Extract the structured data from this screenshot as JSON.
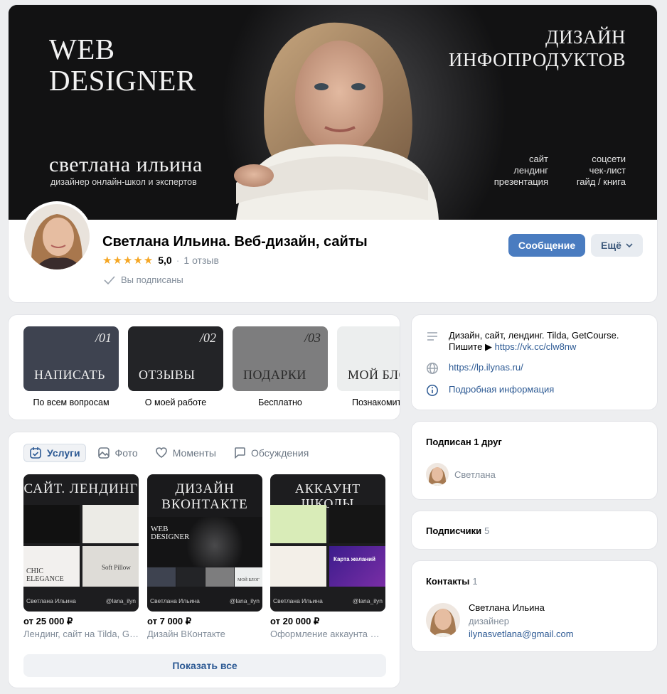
{
  "cover": {
    "title_line1": "WEB",
    "title_line2": "DESIGNER",
    "name": "светлана ильина",
    "subtitle": "дизайнер онлайн-школ и экспертов",
    "right_line1": "ДИЗАЙН",
    "right_line2": "ИНФОПРОДУКТОВ",
    "list_left": [
      "сайт",
      "лендинг",
      "презентация"
    ],
    "list_right": [
      "соцсети",
      "чек-лист",
      "гайд / книга"
    ]
  },
  "group": {
    "title": "Светлана Ильина. Веб-дизайн, сайты",
    "rating": "5,0",
    "reviews": "1 отзыв",
    "subscribed": "Вы подписаны",
    "message_button": "Сообщение",
    "more_button": "Ещё"
  },
  "quick_links": [
    {
      "num": "/01",
      "title": "НАПИСАТЬ",
      "caption": "По всем вопросам",
      "color": "#3e4350"
    },
    {
      "num": "/02",
      "title": "ОТЗЫВЫ",
      "caption": "О моей работе",
      "color": "#232427"
    },
    {
      "num": "/03",
      "title": "ПОДАРКИ",
      "caption": "Бесплатно",
      "color": "#7d7d7e"
    },
    {
      "num": "",
      "title": "МОЙ БЛОГ",
      "caption": "Познакомиться",
      "color": "#eceeee"
    }
  ],
  "tabs": [
    {
      "label": "Услуги",
      "icon": "calendar-check-icon"
    },
    {
      "label": "Фото",
      "icon": "image-icon"
    },
    {
      "label": "Моменты",
      "icon": "heart-story-icon"
    },
    {
      "label": "Обсуждения",
      "icon": "chat-icon"
    }
  ],
  "services": [
    {
      "img_title": "САЙТ. ЛЕНДИНГ",
      "footer_left": "Светлана Ильина",
      "footer_right": "@lana_ilyn",
      "inner1": "CHIC ELEGANCE",
      "inner2": "Soft Pillow",
      "price": "от 25 000 ₽",
      "desc": "Лендинг, сайт на Tilda, GetCourse"
    },
    {
      "img_title": "ДИЗАЙН ВКОНТАКТЕ",
      "footer_left": "Светлана Ильина",
      "footer_right": "@lana_ilyn",
      "inner1": "WEB DESIGNER",
      "inner2": "МОЙ БЛОГ",
      "price": "от 7 000 ₽",
      "desc": "Дизайн ВКонтакте"
    },
    {
      "img_title": "АККАУНТ ШКОЛЫ",
      "footer_left": "Светлана Ильина",
      "footer_right": "@lana_ilyn",
      "inner1": "Карта желаний",
      "inner2": "",
      "price": "от 20 000 ₽",
      "desc": "Оформление аккаунта школы"
    }
  ],
  "show_all": "Показать все",
  "info": {
    "description_line1": "Дизайн, сайт, лендинг. Tilda, GetCourse.",
    "description_line2_prefix": "Пишите ▶ ",
    "description_link": "https://vk.cc/clw8nw",
    "website": "https://lp.ilynas.ru/",
    "details": "Подробная информация"
  },
  "friends": {
    "title": "Подписан 1 друг",
    "friend_name": "Светлана"
  },
  "subscribers": {
    "title": "Подписчики",
    "count": "5"
  },
  "contacts": {
    "title": "Контакты",
    "count": "1",
    "name": "Светлана Ильина",
    "role": "дизайнер",
    "email": "ilynasvetlana@gmail.com"
  }
}
